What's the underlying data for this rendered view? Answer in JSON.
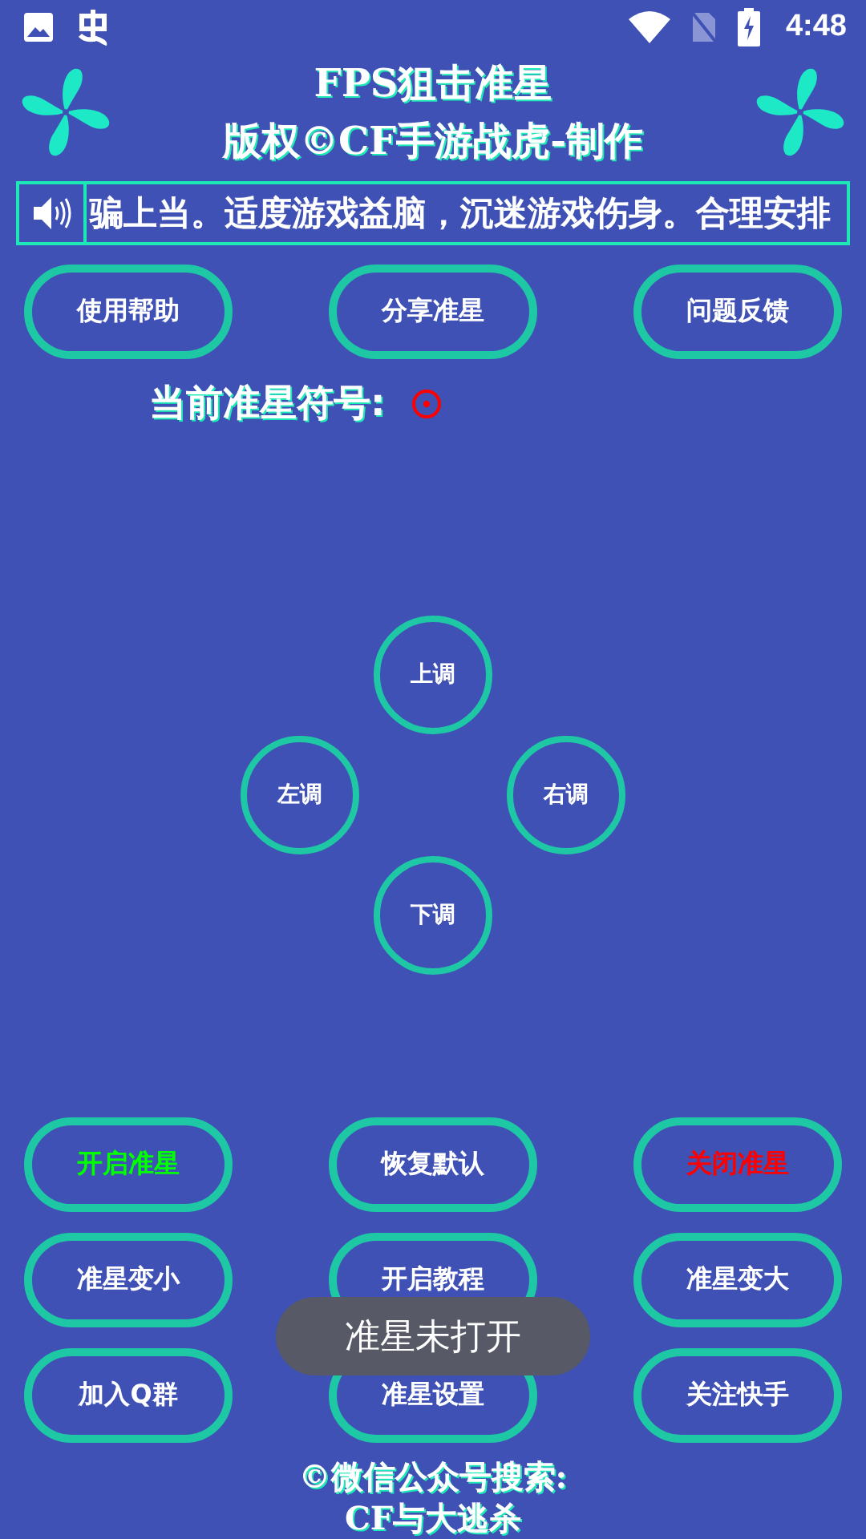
{
  "status_bar": {
    "time": "4:48"
  },
  "header": {
    "title": "FPS狙击准星",
    "subtitle": "版权©CF手游战虎-制作"
  },
  "marquee": {
    "text": "骗上当。适度游戏益脑，沉迷游戏伤身。合理安排"
  },
  "top_buttons": [
    {
      "label": "使用帮助"
    },
    {
      "label": "分享准星"
    },
    {
      "label": "问题反馈"
    }
  ],
  "crosshair": {
    "label": "当前准星符号:",
    "color": "#ff0000"
  },
  "dpad": [
    {
      "kind": "up",
      "label": "上调"
    },
    {
      "kind": "left",
      "label": "左调"
    },
    {
      "kind": "right",
      "label": "右调"
    },
    {
      "kind": "down",
      "label": "下调"
    }
  ],
  "bottom_buttons": [
    {
      "label": "开启准星",
      "color": "#00ff00"
    },
    {
      "label": "恢复默认",
      "color": "#ffffff"
    },
    {
      "label": "关闭准星",
      "color": "#ff0000"
    },
    {
      "label": "准星变小",
      "color": "#ffffff"
    },
    {
      "label": "开启教程",
      "color": "#ffffff"
    },
    {
      "label": "准星变大",
      "color": "#ffffff"
    },
    {
      "label": "加入Q群",
      "color": "#ffffff"
    },
    {
      "label": "准星设置",
      "color": "#ffffff"
    },
    {
      "label": "关注快手",
      "color": "#ffffff"
    }
  ],
  "footer": {
    "line_1": "©微信公众号搜索:",
    "line_2": "CF与大逃杀"
  },
  "toast": {
    "text": "准星未打开"
  }
}
